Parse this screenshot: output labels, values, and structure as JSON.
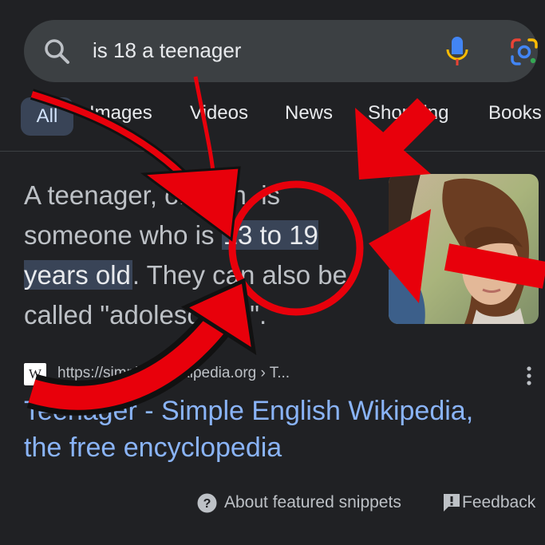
{
  "search": {
    "query": "is 18 a teenager",
    "icon": "search-icon",
    "mic_icon": "mic-icon",
    "lens_icon": "google-lens-icon"
  },
  "tabs": [
    {
      "label": "All",
      "active": true
    },
    {
      "label": "Images"
    },
    {
      "label": "Videos"
    },
    {
      "label": "News"
    },
    {
      "label": "Shopping"
    },
    {
      "label": "Books"
    }
  ],
  "snippet": {
    "part1": "A teenager, or teen, is someone who is ",
    "highlight": "13 to 19 years old",
    "part2": ". They can also be called \"adolescents\"."
  },
  "source": {
    "favicon": "W",
    "url": "https://simple.m.wikipedia.org › T..."
  },
  "result": {
    "title": "Teenager - Simple English Wikipedia, the free encyclopedia"
  },
  "footer": {
    "about": "About featured snippets",
    "feedback": "Feedback"
  },
  "colors": {
    "background": "#202124",
    "link": "#8ab4f8",
    "highlight": "#394457",
    "annotation_red": "#e8000b"
  }
}
